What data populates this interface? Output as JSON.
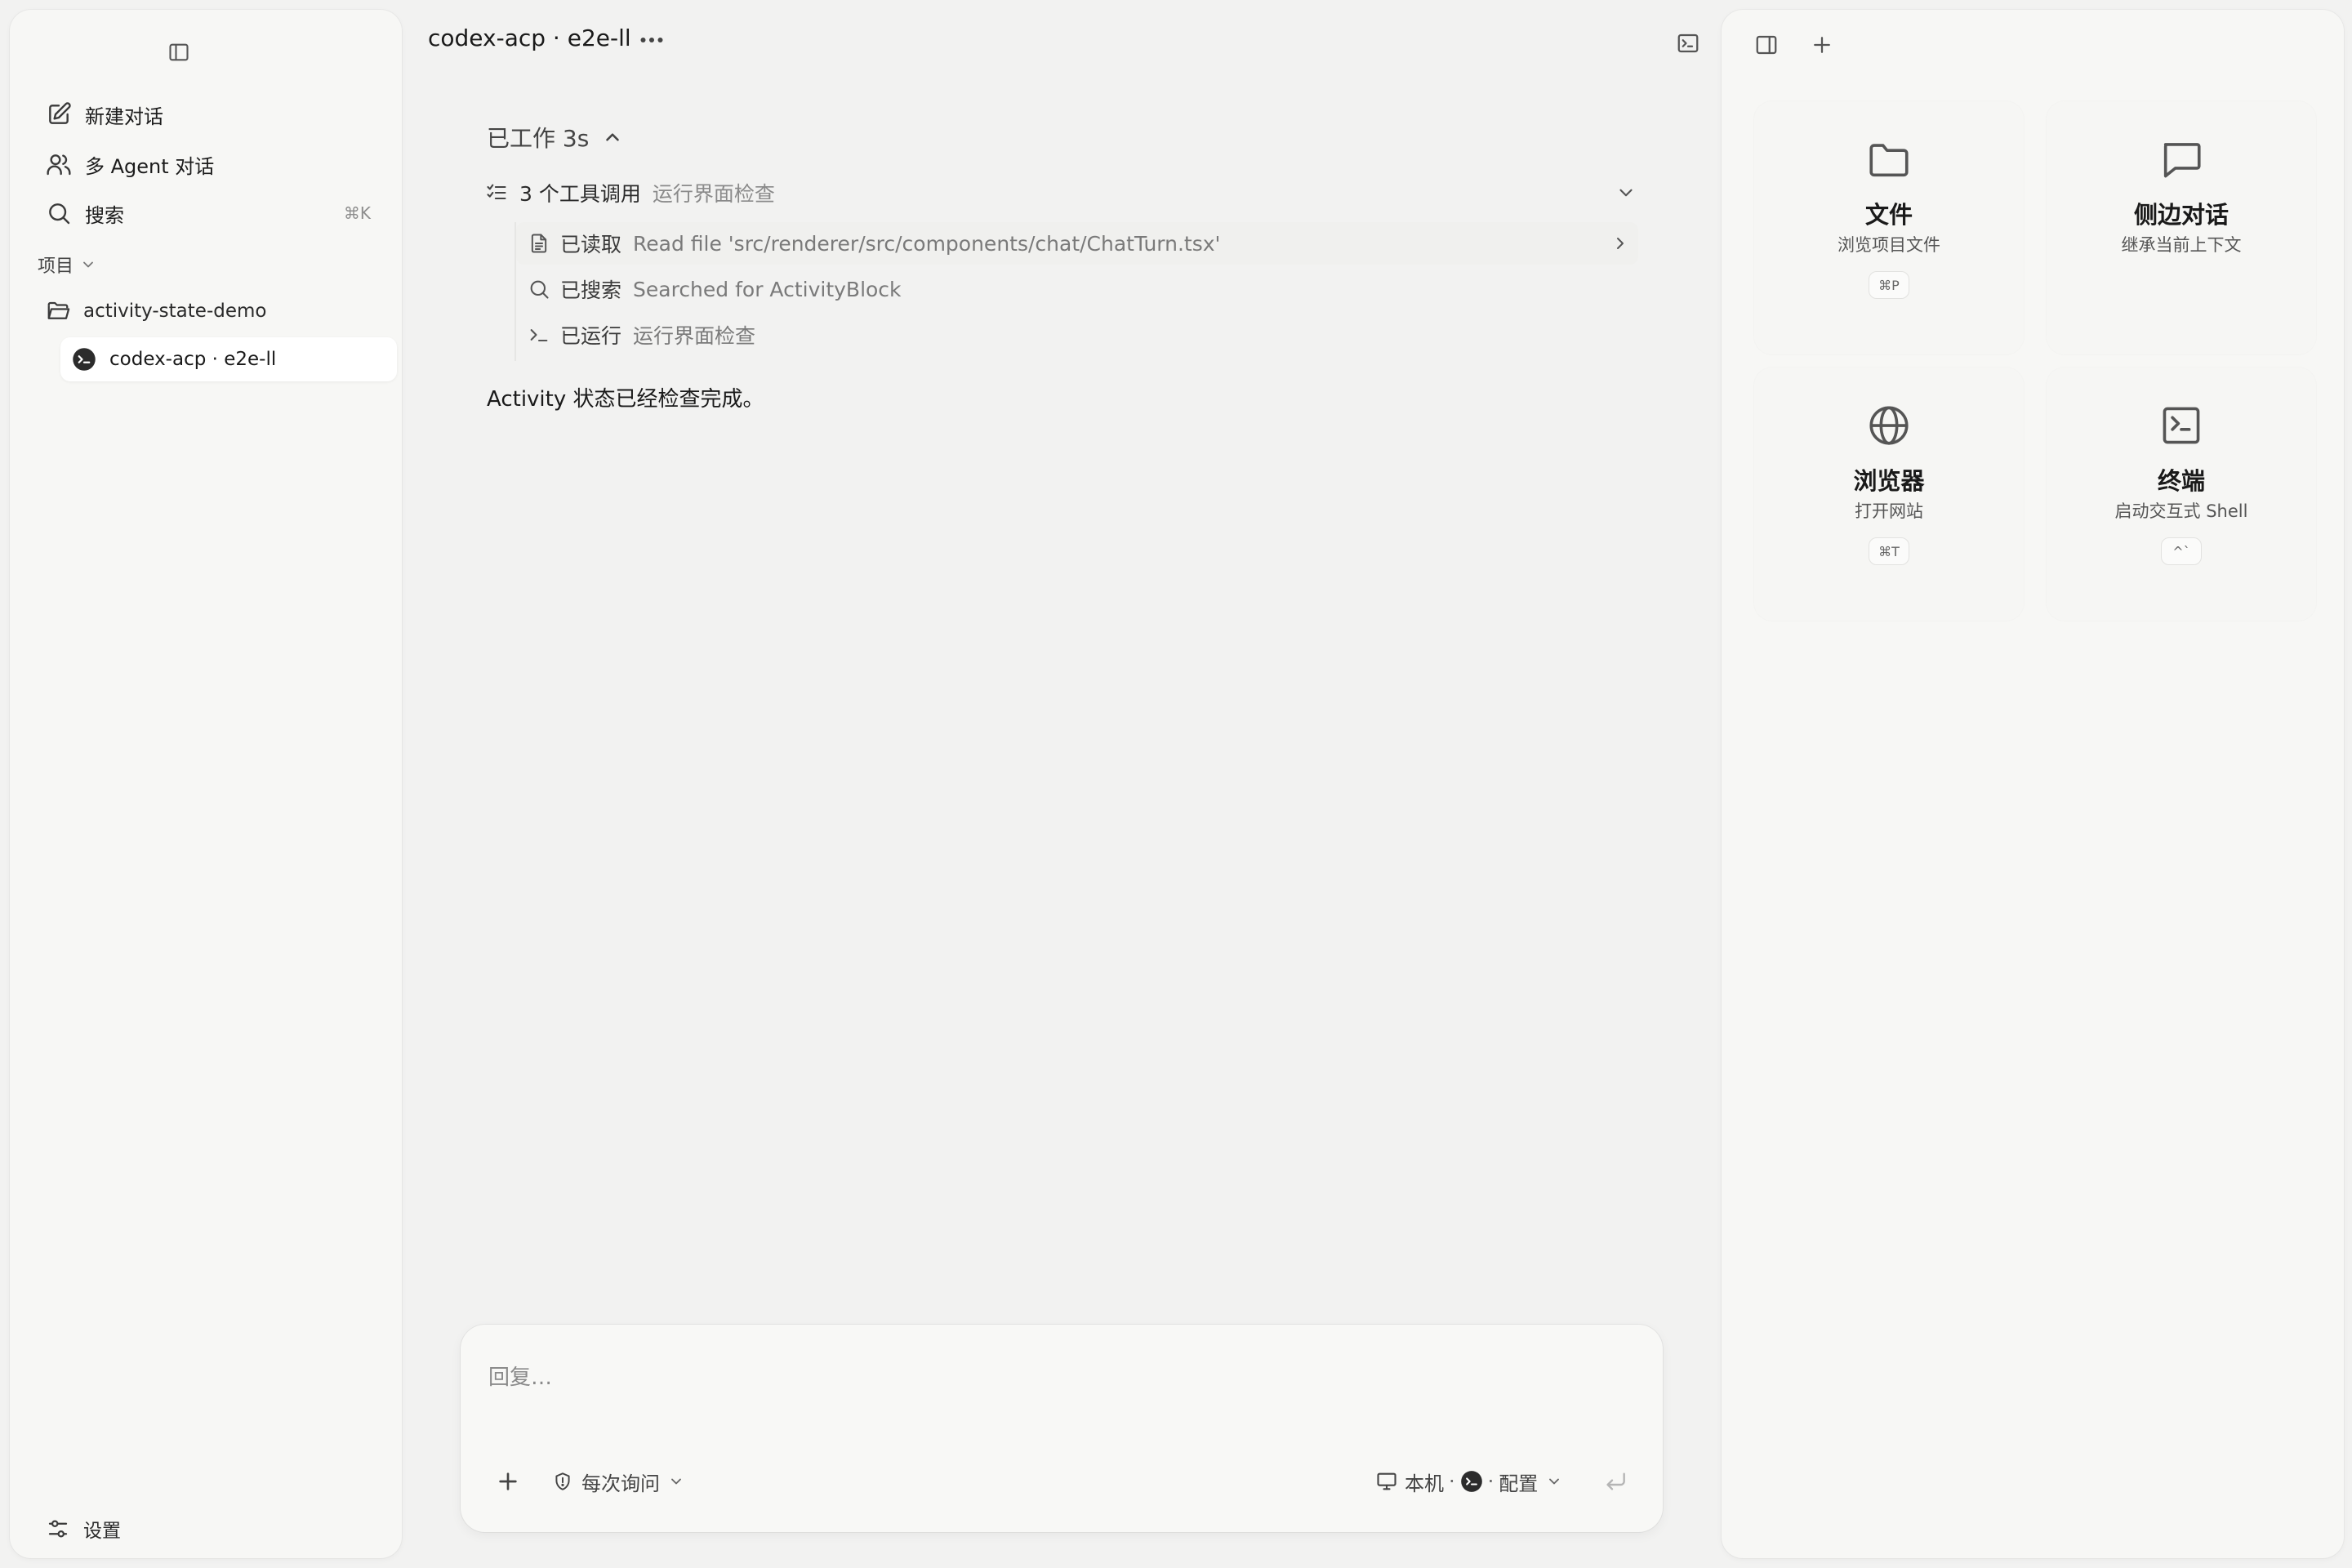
{
  "sidebar": {
    "new_chat": "新建对话",
    "multi_agent": "多 Agent 对话",
    "search": "搜索",
    "search_shortcut": "⌘K",
    "section_label": "项目",
    "project_name": "activity-state-demo",
    "session_name": "codex-acp · e2e-ll",
    "settings": "设置"
  },
  "header": {
    "title": "codex-acp · e2e-ll"
  },
  "chat": {
    "worked": "已工作 3s",
    "tool_summary": {
      "count": "3 个工具调用",
      "desc": "运行界面检查"
    },
    "tools": [
      {
        "icon": "file-icon",
        "action": "已读取",
        "detail": "Read file 'src/renderer/src/components/chat/ChatTurn.tsx'"
      },
      {
        "icon": "search-icon",
        "action": "已搜索",
        "detail": "Searched for ActivityBlock"
      },
      {
        "icon": "terminal-prompt-icon",
        "action": "已运行",
        "detail": "运行界面检查"
      }
    ],
    "result": "Activity 状态已经检查完成。"
  },
  "composer": {
    "placeholder": "回复…",
    "permission": "每次询问",
    "env_host": "本机",
    "env_config": "配置"
  },
  "right_panel": {
    "tiles": [
      {
        "icon": "folder-icon",
        "title": "文件",
        "subtitle": "浏览项目文件",
        "shortcut": "⌘P"
      },
      {
        "icon": "chat-bubble-icon",
        "title": "侧边对话",
        "subtitle": "继承当前上下文",
        "shortcut": ""
      },
      {
        "icon": "globe-icon",
        "title": "浏览器",
        "subtitle": "打开网站",
        "shortcut": "⌘T"
      },
      {
        "icon": "terminal-icon",
        "title": "终端",
        "subtitle": "启动交互式 Shell",
        "shortcut": "^`"
      }
    ]
  },
  "colors": {
    "background": "#f2f2f1",
    "panel": "#f7f7f5",
    "text": "#1a1a1a",
    "muted": "#8a8a8a"
  }
}
